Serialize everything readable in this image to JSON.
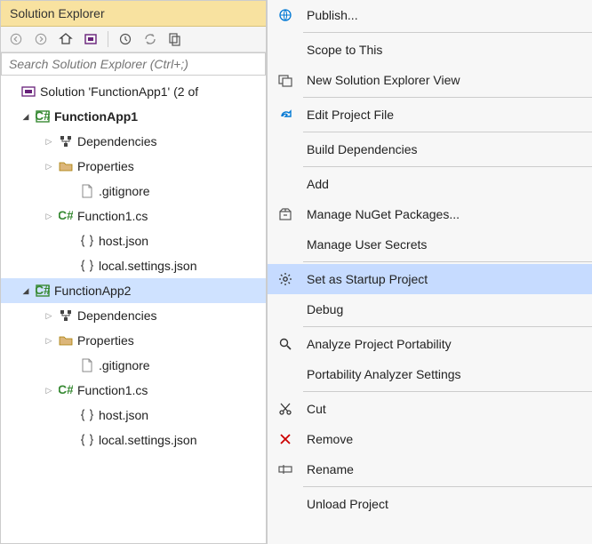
{
  "panelTitle": "Solution Explorer",
  "searchPlaceholder": "Search Solution Explorer (Ctrl+;)",
  "tree": {
    "solution": "Solution 'FunctionApp1' (2 of ",
    "project1": "FunctionApp1",
    "deps": "Dependencies",
    "props": "Properties",
    "gitignore": ".gitignore",
    "func1": "Function1.cs",
    "host": "host.json",
    "local": "local.settings.json",
    "project2": "FunctionApp2"
  },
  "menu": {
    "publish": "Publish...",
    "scope": "Scope to This",
    "newView": "New Solution Explorer View",
    "editProj": "Edit Project File",
    "buildDeps": "Build Dependencies",
    "add": "Add",
    "nuget": "Manage NuGet Packages...",
    "secrets": "Manage User Secrets",
    "startup": "Set as Startup Project",
    "debug": "Debug",
    "analyze": "Analyze Project Portability",
    "portability": "Portability Analyzer Settings",
    "cut": "Cut",
    "remove": "Remove",
    "rename": "Rename",
    "unload": "Unload Project"
  }
}
